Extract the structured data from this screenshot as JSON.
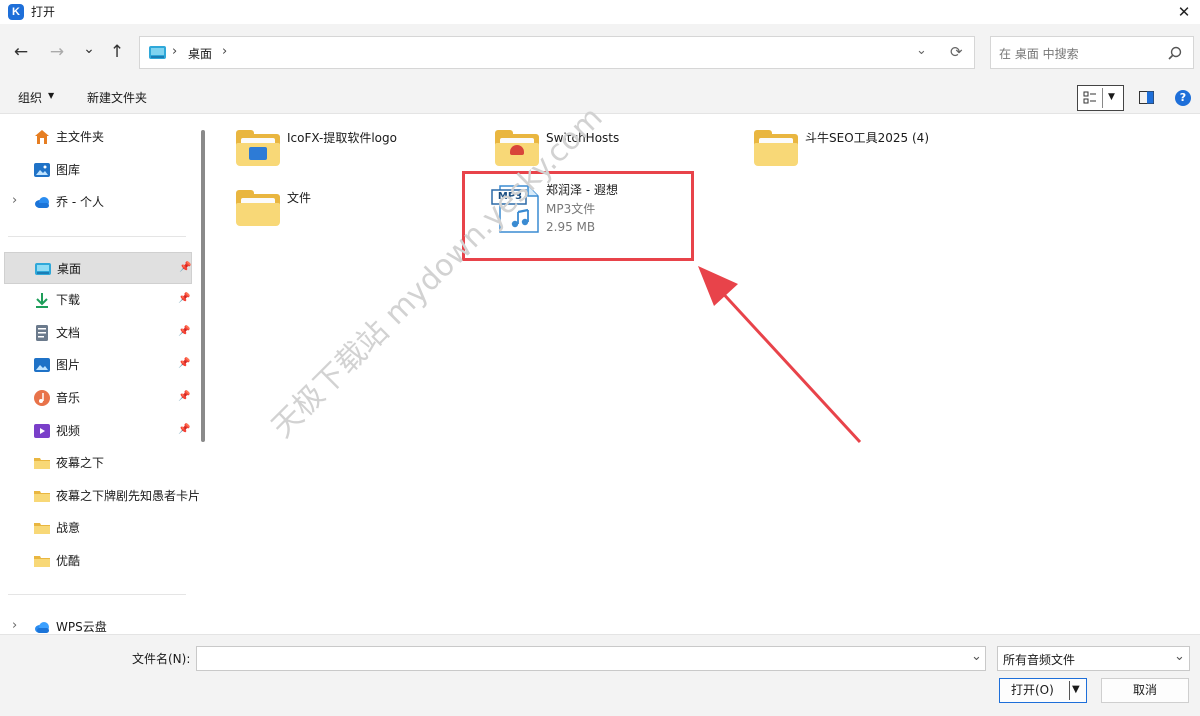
{
  "window": {
    "title": "打开",
    "app_icon_letter": "K",
    "close_glyph": "✕"
  },
  "nav": {
    "back_glyph": "←",
    "forward_glyph": "→",
    "recent_glyph": "⌄",
    "up_glyph": "↑",
    "breadcrumb": [
      "桌面"
    ],
    "search_placeholder": "在 桌面 中搜索"
  },
  "toolbar": {
    "organize_label": "组织",
    "new_folder_label": "新建文件夹",
    "help_glyph": "?"
  },
  "sidebar": {
    "quick": [
      {
        "label": "主文件夹",
        "icon": "home-icon"
      },
      {
        "label": "图库",
        "icon": "gallery-icon"
      },
      {
        "label": "乔 - 个人",
        "icon": "onedrive-cloud-icon",
        "expandable": true
      }
    ],
    "pinned": [
      {
        "label": "桌面",
        "icon": "desktop-icon",
        "selected": true,
        "pinned": true
      },
      {
        "label": "下载",
        "icon": "download-icon",
        "pinned": true
      },
      {
        "label": "文档",
        "icon": "document-icon",
        "pinned": true
      },
      {
        "label": "图片",
        "icon": "pictures-icon",
        "pinned": true
      },
      {
        "label": "音乐",
        "icon": "music-icon",
        "pinned": true
      },
      {
        "label": "视频",
        "icon": "videos-icon",
        "pinned": true
      },
      {
        "label": "夜幕之下",
        "icon": "folder-icon"
      },
      {
        "label": "夜幕之下牌剧先知愚者卡片",
        "icon": "folder-icon"
      },
      {
        "label": "战意",
        "icon": "folder-icon"
      },
      {
        "label": "优酷",
        "icon": "folder-icon"
      }
    ],
    "cloud": [
      {
        "label": "WPS云盘",
        "icon": "wps-cloud-icon",
        "expandable": true
      }
    ]
  },
  "files": [
    {
      "name": "IcoFX-提取软件logo",
      "type": "folder"
    },
    {
      "name": "SwitchHosts",
      "type": "folder"
    },
    {
      "name": "斗牛SEO工具2025 (4)",
      "type": "folder"
    },
    {
      "name": "文件",
      "type": "folder"
    },
    {
      "name": "郑润泽 - 遐想",
      "type": "mp3",
      "badge": "MP3",
      "kind": "MP3文件",
      "size": "2.95 MB",
      "highlighted": true
    }
  ],
  "annotation": {
    "highlight_color": "#e8434a",
    "arrow_color": "#e8434a"
  },
  "watermark": {
    "text": "天极下载站 mydown.yesky.com"
  },
  "bottom": {
    "filename_label": "文件名(N):",
    "filename_value": "",
    "filetype_value": "所有音频文件",
    "open_label": "打开(O)",
    "cancel_label": "取消"
  },
  "colors": {
    "accent": "#1e6fd9",
    "folder": "#f8d877",
    "selected_bg": "#e0e0e0"
  }
}
